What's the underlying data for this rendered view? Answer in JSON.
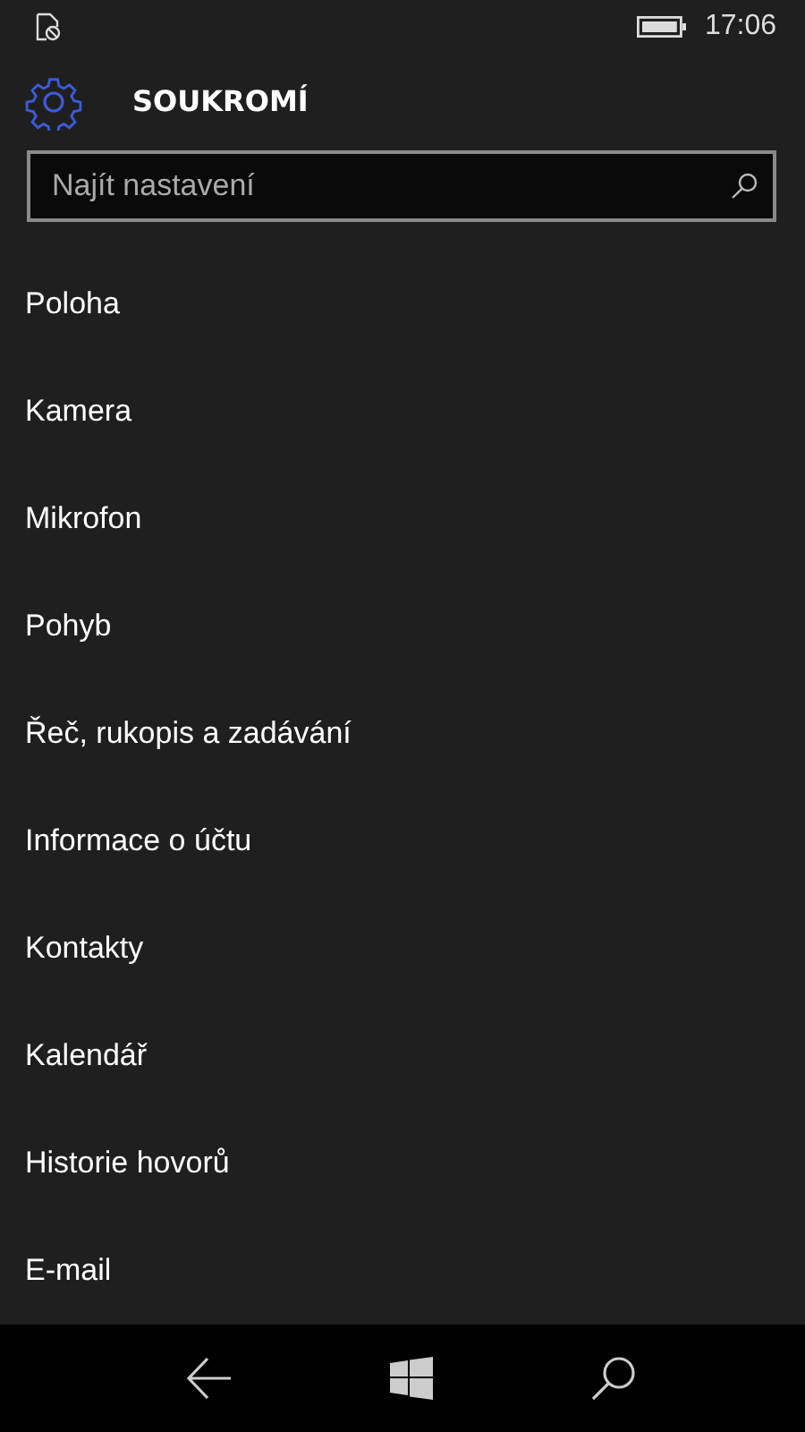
{
  "status_bar": {
    "time": "17:06"
  },
  "header": {
    "title": "SOUKROMÍ"
  },
  "search": {
    "placeholder": "Najít nastavení"
  },
  "items": [
    "Poloha",
    "Kamera",
    "Mikrofon",
    "Pohyb",
    "Řeč, rukopis a zadávání",
    "Informace o účtu",
    "Kontakty",
    "Kalendář",
    "Historie hovorů",
    "E-mail"
  ]
}
